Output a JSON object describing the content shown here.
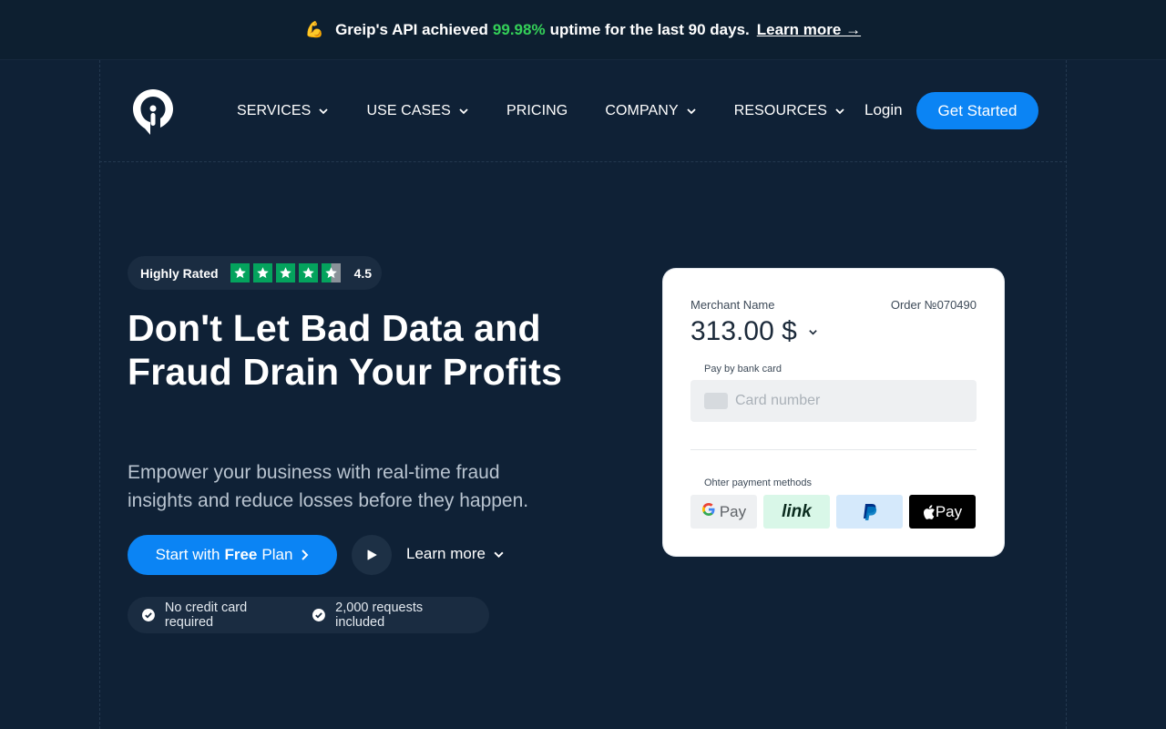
{
  "announcement": {
    "emoji": "💪",
    "prefix": "Greip's API achieved",
    "uptime": "99.98%",
    "suffix": "uptime for the last 90 days.",
    "link_label": "Learn more →"
  },
  "nav": {
    "items": [
      {
        "label": "SERVICES",
        "has_dropdown": true
      },
      {
        "label": "USE CASES",
        "has_dropdown": true
      },
      {
        "label": "PRICING",
        "has_dropdown": false
      },
      {
        "label": "COMPANY",
        "has_dropdown": true
      },
      {
        "label": "RESOURCES",
        "has_dropdown": true
      }
    ],
    "login_label": "Login",
    "get_started_label": "Get Started"
  },
  "rating": {
    "label": "Highly Rated",
    "score": "4.5",
    "stars_value": 4.5,
    "stars_max": 5
  },
  "hero": {
    "headline": "Don't Let Bad Data and Fraud Drain Your Profits",
    "subtext": "Empower your business with real-time fraud insights and reduce losses before they happen.",
    "cta_prefix": "Start with",
    "cta_bold": "Free",
    "cta_suffix": "Plan",
    "learn_more_label": "Learn more"
  },
  "features": [
    "No credit card required",
    "2,000 requests included"
  ],
  "payment_card": {
    "merchant_label": "Merchant Name",
    "order_label": "Order №070490",
    "amount": "313.00 $",
    "pay_by_label": "Pay by bank card",
    "card_placeholder": "Card number",
    "other_methods_label": "Ohter payment methods",
    "methods": {
      "gpay_label": "Pay",
      "link_label": "link",
      "apple_label": "Pay"
    }
  },
  "colors": {
    "background": "#0f2136",
    "accent": "#0b84f4",
    "uptime_green": "#34d058",
    "trustpilot_green": "#04a35d"
  }
}
